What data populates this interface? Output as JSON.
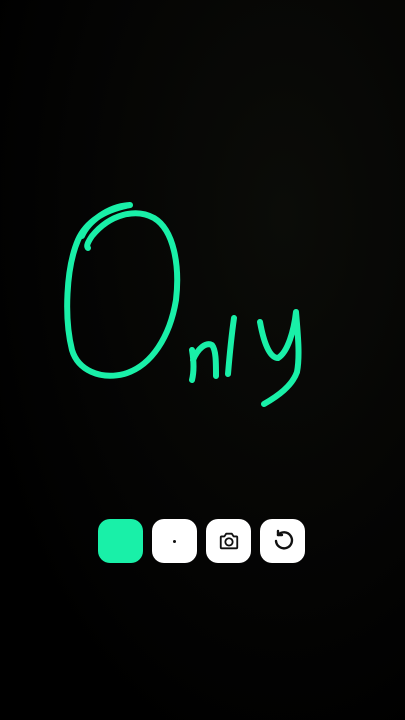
{
  "drawing": {
    "handwritten_text": "Only",
    "stroke_color": "#19f0a8"
  },
  "toolbar": {
    "color_swatch": {
      "color": "#19f0a8",
      "icon": "color-swatch"
    },
    "brush_size": {
      "icon": "dot-icon"
    },
    "snapshot": {
      "icon": "camera-icon"
    },
    "reset": {
      "icon": "rotate-ccw-icon"
    }
  }
}
